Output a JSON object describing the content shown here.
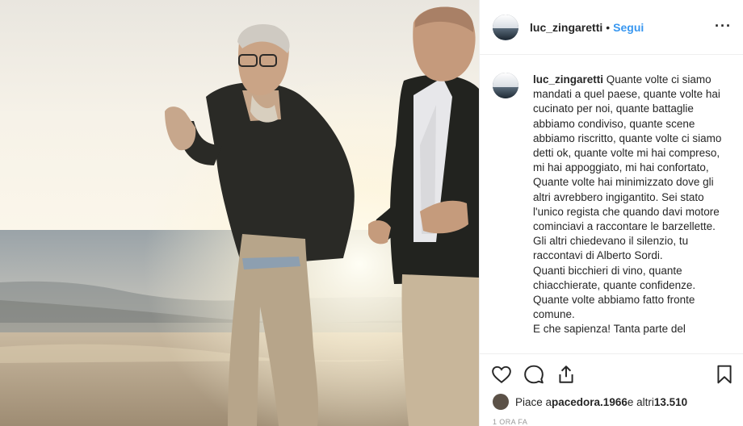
{
  "post": {
    "username": "luc_zingaretti",
    "separator": "•",
    "follow_label": "Segui",
    "more_label": "···",
    "caption_username": "luc_zingaretti",
    "caption_lines": [
      "Quante volte ci siamo mandati a quel paese, quante volte hai cucinato per noi, quante battaglie abbiamo condiviso, quante scene abbiamo riscritto, quante volte ci siamo detti ok, quante volte mi hai compreso, mi hai appoggiato, mi hai confortato,",
      "Quante volte hai minimizzato dove gli altri avrebbero ingigantito. Sei stato l'unico regista che quando davi motore cominciavi a raccontare le barzellette.",
      "Gli altri chiedevano il silenzio, tu raccontavi di Alberto Sordi.",
      "Quanti bicchieri di vino, quante chiacchierate, quante confidenze.",
      "Quante volte abbiamo fatto fronte comune.",
      "E che sapienza! Tanta parte del"
    ],
    "likes_prefix": "Piace a ",
    "likes_user": "pacedora.1966",
    "likes_middle": " e altri ",
    "likes_count": "13.510",
    "time_ago": "1 ORA FA"
  },
  "icons": {
    "like": "heart-icon",
    "comment": "comment-icon",
    "share": "share-icon",
    "save": "bookmark-icon"
  },
  "colors": {
    "accent": "#3897f0",
    "text": "#262626",
    "muted": "#999999",
    "border": "#efefef"
  }
}
